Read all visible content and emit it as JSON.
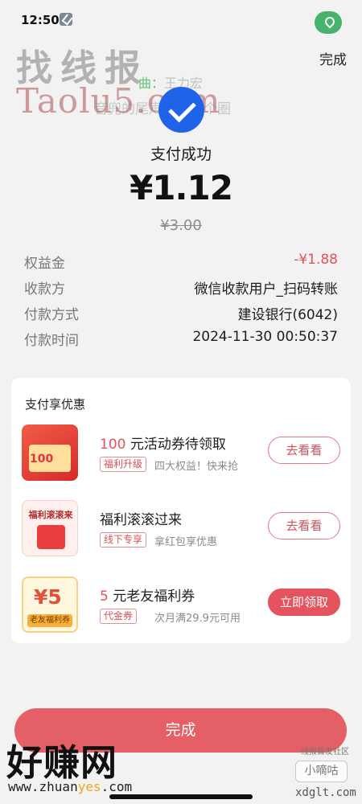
{
  "status_bar": {
    "time": "12:50",
    "tool_icon": "wrench-icon",
    "location_icon": "location-pin-icon",
    "location_color": "#45b36b"
  },
  "header": {
    "done_label": "完成",
    "watermark_cn": "找线报",
    "watermark_en": "Taolu5.com",
    "music_prefix": "曲：",
    "music_artist": "王力宏",
    "lyric": "音兜的尾声盘成一个圈",
    "success_icon": "checkmark-icon",
    "success_color": "#1e63e8"
  },
  "payment": {
    "status": "支付成功",
    "amount": "¥1.12",
    "original_price": "¥3.00",
    "details": [
      {
        "label": "权益金",
        "value": "-¥1.88",
        "highlight": true
      },
      {
        "label": "收款方",
        "value": "微信收款用户_扫码转账",
        "highlight": false
      },
      {
        "label": "付款方式",
        "value": "建设银行(6042)",
        "highlight": false
      },
      {
        "label": "付款时间",
        "value": "2024-11-30 00:50:37",
        "highlight": false
      }
    ]
  },
  "offers": {
    "title": "支付享优惠",
    "items": [
      {
        "prefix": "100",
        "name": "元活动券待领取",
        "tag": "福利升级",
        "description": "四大权益！快来抢",
        "button": "去看看",
        "thumb_text": "100",
        "thumb_icon": "red-envelope-icon"
      },
      {
        "prefix": "",
        "name": "福利滚滚过来",
        "tag": "线下专享",
        "description": "拿红包享优惠",
        "button": "去看看",
        "thumb_text": "福利滚滚来",
        "thumb_icon": "slot-machine-icon"
      },
      {
        "prefix": "5",
        "name": "元老友福利券",
        "tag": "代金券",
        "description": "次月满29.9元可用",
        "button": "立即领取",
        "thumb_big": "¥5",
        "thumb_text": "老友福利券",
        "thumb_icon": "coupon-icon"
      }
    ]
  },
  "footer": {
    "done_label": "完成",
    "brand_cn": "好赚网",
    "site_left": "www.zhuan",
    "site_accent": "yes",
    "site_right": ".com",
    "community": "线报首发社区",
    "small_brand": "小嘀咕",
    "small_site": "xdglt.com",
    "accent_color": "#e55f66"
  }
}
